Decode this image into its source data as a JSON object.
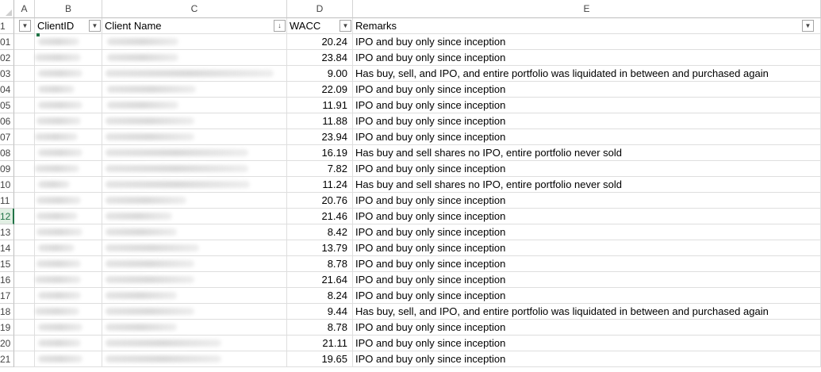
{
  "columns": [
    "A",
    "B",
    "C",
    "D",
    "E"
  ],
  "headers": {
    "b": "ClientID",
    "c": "Client Name",
    "d": "WACC",
    "e": "Remarks"
  },
  "sort_icon": "sort-ascending-icon",
  "filter_icon": "filter-dropdown-icon",
  "header_row_number": "1",
  "rows": [
    {
      "num": "01",
      "wacc": "20.24",
      "remarks": "IPO and buy only since inception"
    },
    {
      "num": "02",
      "wacc": "23.84",
      "remarks": "IPO and buy only since inception"
    },
    {
      "num": "03",
      "wacc": "9.00",
      "remarks": "Has buy, sell, and IPO, and entire portfolio was liquidated in between and purchased again"
    },
    {
      "num": "04",
      "wacc": "22.09",
      "remarks": "IPO and buy only since inception"
    },
    {
      "num": "05",
      "wacc": "11.91",
      "remarks": "IPO and buy only since inception"
    },
    {
      "num": "06",
      "wacc": "11.88",
      "remarks": "IPO and buy only since inception"
    },
    {
      "num": "07",
      "wacc": "23.94",
      "remarks": "IPO and buy only since inception"
    },
    {
      "num": "08",
      "wacc": "16.19",
      "remarks": "Has buy and sell shares no IPO, entire portfolio never sold"
    },
    {
      "num": "09",
      "wacc": "7.82",
      "remarks": "IPO and buy only since inception"
    },
    {
      "num": "10",
      "wacc": "11.24",
      "remarks": "Has buy and sell shares no IPO, entire portfolio never sold"
    },
    {
      "num": "11",
      "wacc": "20.76",
      "remarks": "IPO and buy only since inception"
    },
    {
      "num": "12",
      "wacc": "21.46",
      "remarks": "IPO and buy only since inception"
    },
    {
      "num": "13",
      "wacc": "8.42",
      "remarks": "IPO and buy only since inception"
    },
    {
      "num": "14",
      "wacc": "13.79",
      "remarks": "IPO and buy only since inception"
    },
    {
      "num": "15",
      "wacc": "8.78",
      "remarks": "IPO and buy only since inception"
    },
    {
      "num": "16",
      "wacc": "21.64",
      "remarks": "IPO and buy only since inception"
    },
    {
      "num": "17",
      "wacc": "8.24",
      "remarks": "IPO and buy only since inception"
    },
    {
      "num": "18",
      "wacc": "9.44",
      "remarks": "Has buy, sell, and IPO, and entire portfolio was liquidated in between and purchased again"
    },
    {
      "num": "19",
      "wacc": "8.78",
      "remarks": "IPO and buy only since inception"
    },
    {
      "num": "20",
      "wacc": "21.11",
      "remarks": "IPO and buy only since inception"
    },
    {
      "num": "21",
      "wacc": "19.65",
      "remarks": "IPO and buy only since inception"
    }
  ],
  "selected_row": "12",
  "colors": {
    "accent": "#217346",
    "grid": "#dedede"
  }
}
